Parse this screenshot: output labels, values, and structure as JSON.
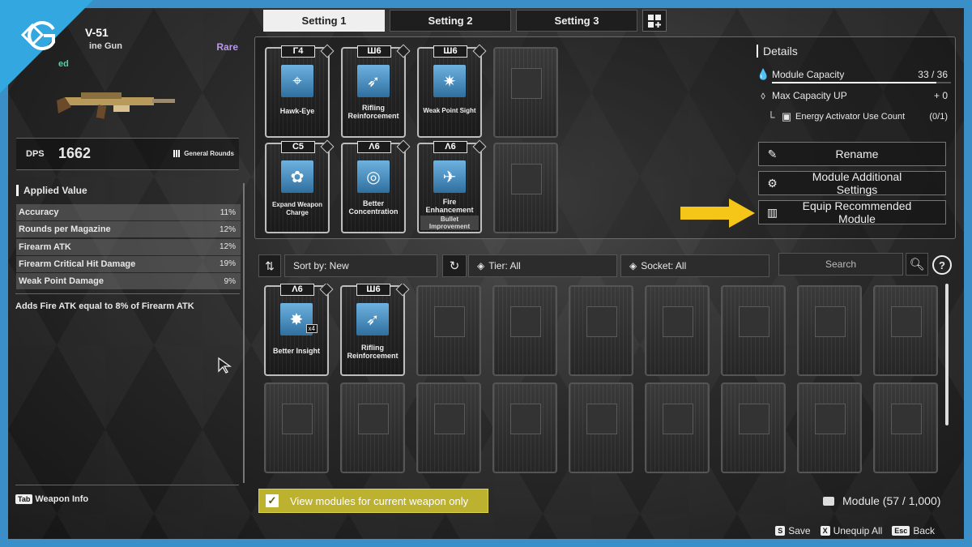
{
  "weapon": {
    "name": "V-51",
    "type": "ine Gun",
    "rarity": "Rare",
    "status": "ed",
    "dps_label": "DPS",
    "dps_value": "1662",
    "ammo_type": "General Rounds"
  },
  "applied": {
    "title": "Applied Value",
    "stats": [
      {
        "name": "Accuracy",
        "value": "11%"
      },
      {
        "name": "Rounds per Magazine",
        "value": "12%"
      },
      {
        "name": "Firearm ATK",
        "value": "12%"
      },
      {
        "name": "Firearm Critical Hit Damage",
        "value": "19%"
      },
      {
        "name": "Weak Point Damage",
        "value": "9%"
      }
    ],
    "note": "Adds Fire ATK equal to 8% of Firearm ATK"
  },
  "weapon_info": {
    "key": "Tab",
    "label": "Weapon Info"
  },
  "tabs": [
    "Setting 1",
    "Setting 2",
    "Setting 3"
  ],
  "equipped": [
    {
      "socket": "Γ4",
      "name": "Hawk-Eye",
      "icon": "crosshair-icon"
    },
    {
      "socket": "Ш6",
      "name": "Rifling Reinforcement",
      "icon": "bullet-icon"
    },
    {
      "socket": "Ш6",
      "name": "Weak Point Sight",
      "icon": "burst-icon"
    },
    {
      "socket": "C5",
      "name": "Expand Weapon Charge",
      "icon": "cylinder-icon"
    },
    {
      "socket": "Λ6",
      "name": "Better Concentration",
      "icon": "concentration-icon"
    },
    {
      "socket": "Λ6",
      "name": "Fire Enhancement",
      "sub": "Bullet Improvement",
      "icon": "fire-icon"
    }
  ],
  "details": {
    "title": "Details",
    "module_capacity_label": "Module Capacity",
    "module_capacity_value": "33 / 36",
    "capacity_fraction": 0.9167,
    "max_capacity_label": "Max Capacity UP",
    "max_capacity_value": "+ 0",
    "energy_label": "Energy Activator Use Count",
    "energy_value": "(0/1)"
  },
  "actions": {
    "rename": "Rename",
    "additional": "Module Additional Settings",
    "recommend": "Equip Recommended Module"
  },
  "filters": {
    "sort": "Sort by: New",
    "tier": "Tier: All",
    "socket": "Socket: All",
    "search_placeholder": "Search"
  },
  "inventory": [
    {
      "socket": "Λ6",
      "name": "Better Insight",
      "count": "x4",
      "icon": "insight-icon"
    },
    {
      "socket": "Ш6",
      "name": "Rifling Reinforcement",
      "icon": "bullet-icon"
    }
  ],
  "view_toggle": "View modules for current weapon only",
  "module_count": "Module (57 / 1,000)",
  "shortcuts": [
    {
      "key": "S",
      "label": "Save"
    },
    {
      "key": "X",
      "label": "Unequip All"
    },
    {
      "key": "Esc",
      "label": "Back"
    }
  ],
  "colors": {
    "accent_blue": "#33a7df",
    "toggle_yellow": "#bdb230",
    "rarity": "#b99ae8",
    "status_green": "#4fd1a7",
    "arrow": "#f5c518"
  }
}
